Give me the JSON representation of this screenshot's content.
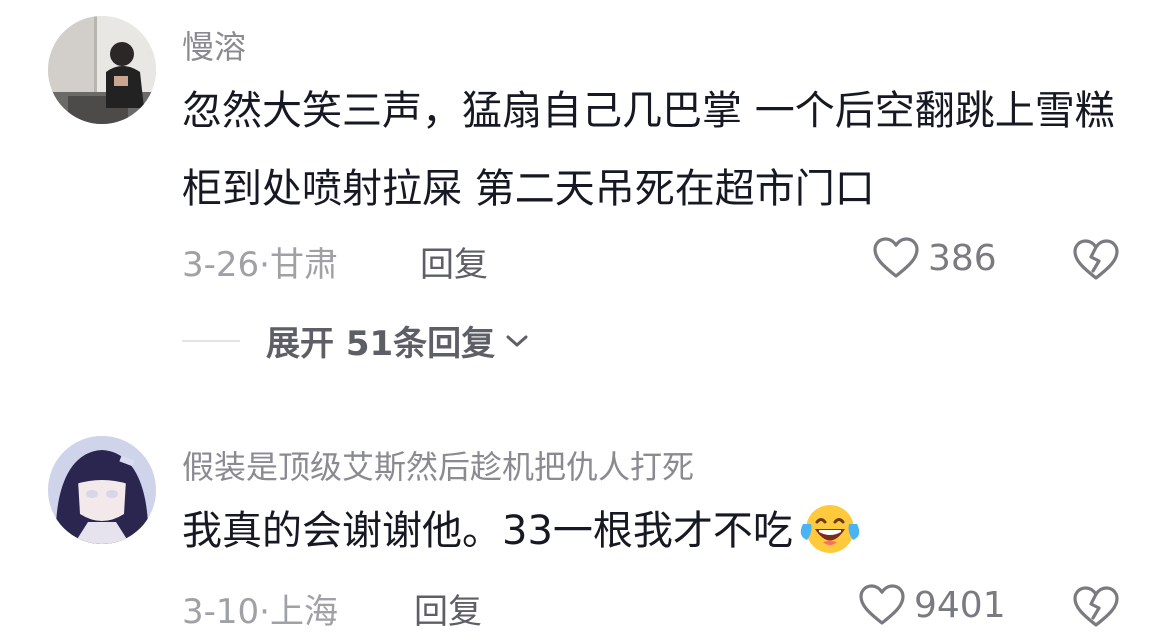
{
  "comments": [
    {
      "username": "慢溶",
      "text": "忽然大笑三声，猛扇自己几巴掌 一个后空翻跳上雪糕柜到处喷射拉屎 第二天吊死在超市门口",
      "date_location": "3-26·甘肃",
      "reply_label": "回复",
      "likes": "386",
      "expand_replies_label": "展开 51条回复"
    },
    {
      "username": "假装是顶级艾斯然后趁机把仇人打死",
      "text": "我真的会谢谢他。33一根我才不吃",
      "emoji": "laughing-with-tears",
      "date_location": "3-10·上海",
      "reply_label": "回复",
      "likes": "9401"
    }
  ],
  "icons": {
    "like": "heart-outline-icon",
    "dislike": "broken-heart-icon",
    "expand": "chevron-down-icon"
  },
  "colors": {
    "username": "#8a8b91",
    "text": "#161823",
    "meta": "#a0a1a6"
  }
}
